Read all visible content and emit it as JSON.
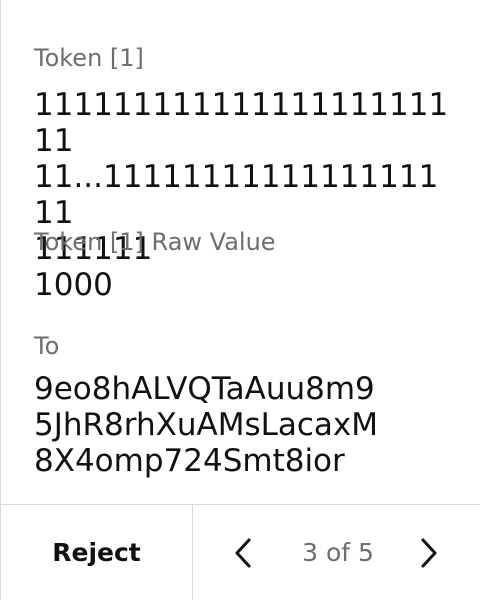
{
  "fields": {
    "token_label": "Token [1]",
    "token_value": "11111111111111111111111\n11...1111111111111111111\n111111",
    "raw_label": "Token [1] Raw Value",
    "raw_value": "1000",
    "to_label": "To",
    "to_value": "9eo8hALVQTaAuu8m9\n5JhR8rhXuAMsLacaxM\n8X4omp724Smt8ior"
  },
  "footer": {
    "reject_label": "Reject",
    "page_indicator": "3 of 5"
  },
  "icons": {
    "prev": "chevron-left-icon",
    "next": "chevron-right-icon"
  },
  "colors": {
    "text": "#111111",
    "muted": "#6e6e6e",
    "divider": "#d9d9d9",
    "background": "#ffffff"
  }
}
